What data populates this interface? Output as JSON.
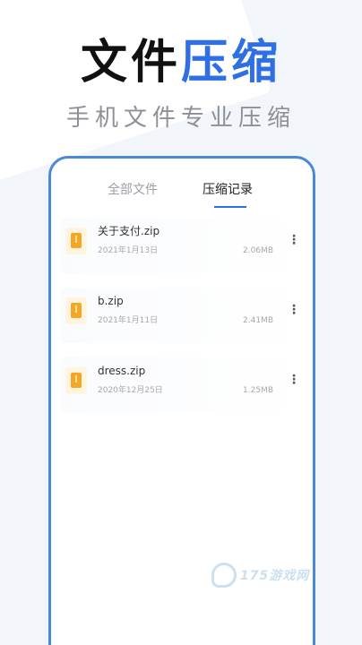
{
  "header": {
    "title_dark": "文件",
    "title_accent": "压缩",
    "subtitle": "手机文件专业压缩"
  },
  "tabs": [
    {
      "label": "全部文件",
      "active": false
    },
    {
      "label": "压缩记录",
      "active": true
    }
  ],
  "files": [
    {
      "name": "关于支付.zip",
      "date": "2021年1月13日",
      "size": "2.06MB",
      "icon": "archive-file-icon"
    },
    {
      "name": "b.zip",
      "date": "2021年1月11日",
      "size": "2.41MB",
      "icon": "archive-file-icon"
    },
    {
      "name": "dress.zip",
      "date": "2020年12月25日",
      "size": "1.25MB",
      "icon": "archive-file-icon"
    }
  ],
  "watermark": {
    "text": "175游戏网"
  },
  "colors": {
    "accent": "#2f6fe4",
    "frame": "#4a88d8",
    "file_icon": "#f5a623"
  }
}
